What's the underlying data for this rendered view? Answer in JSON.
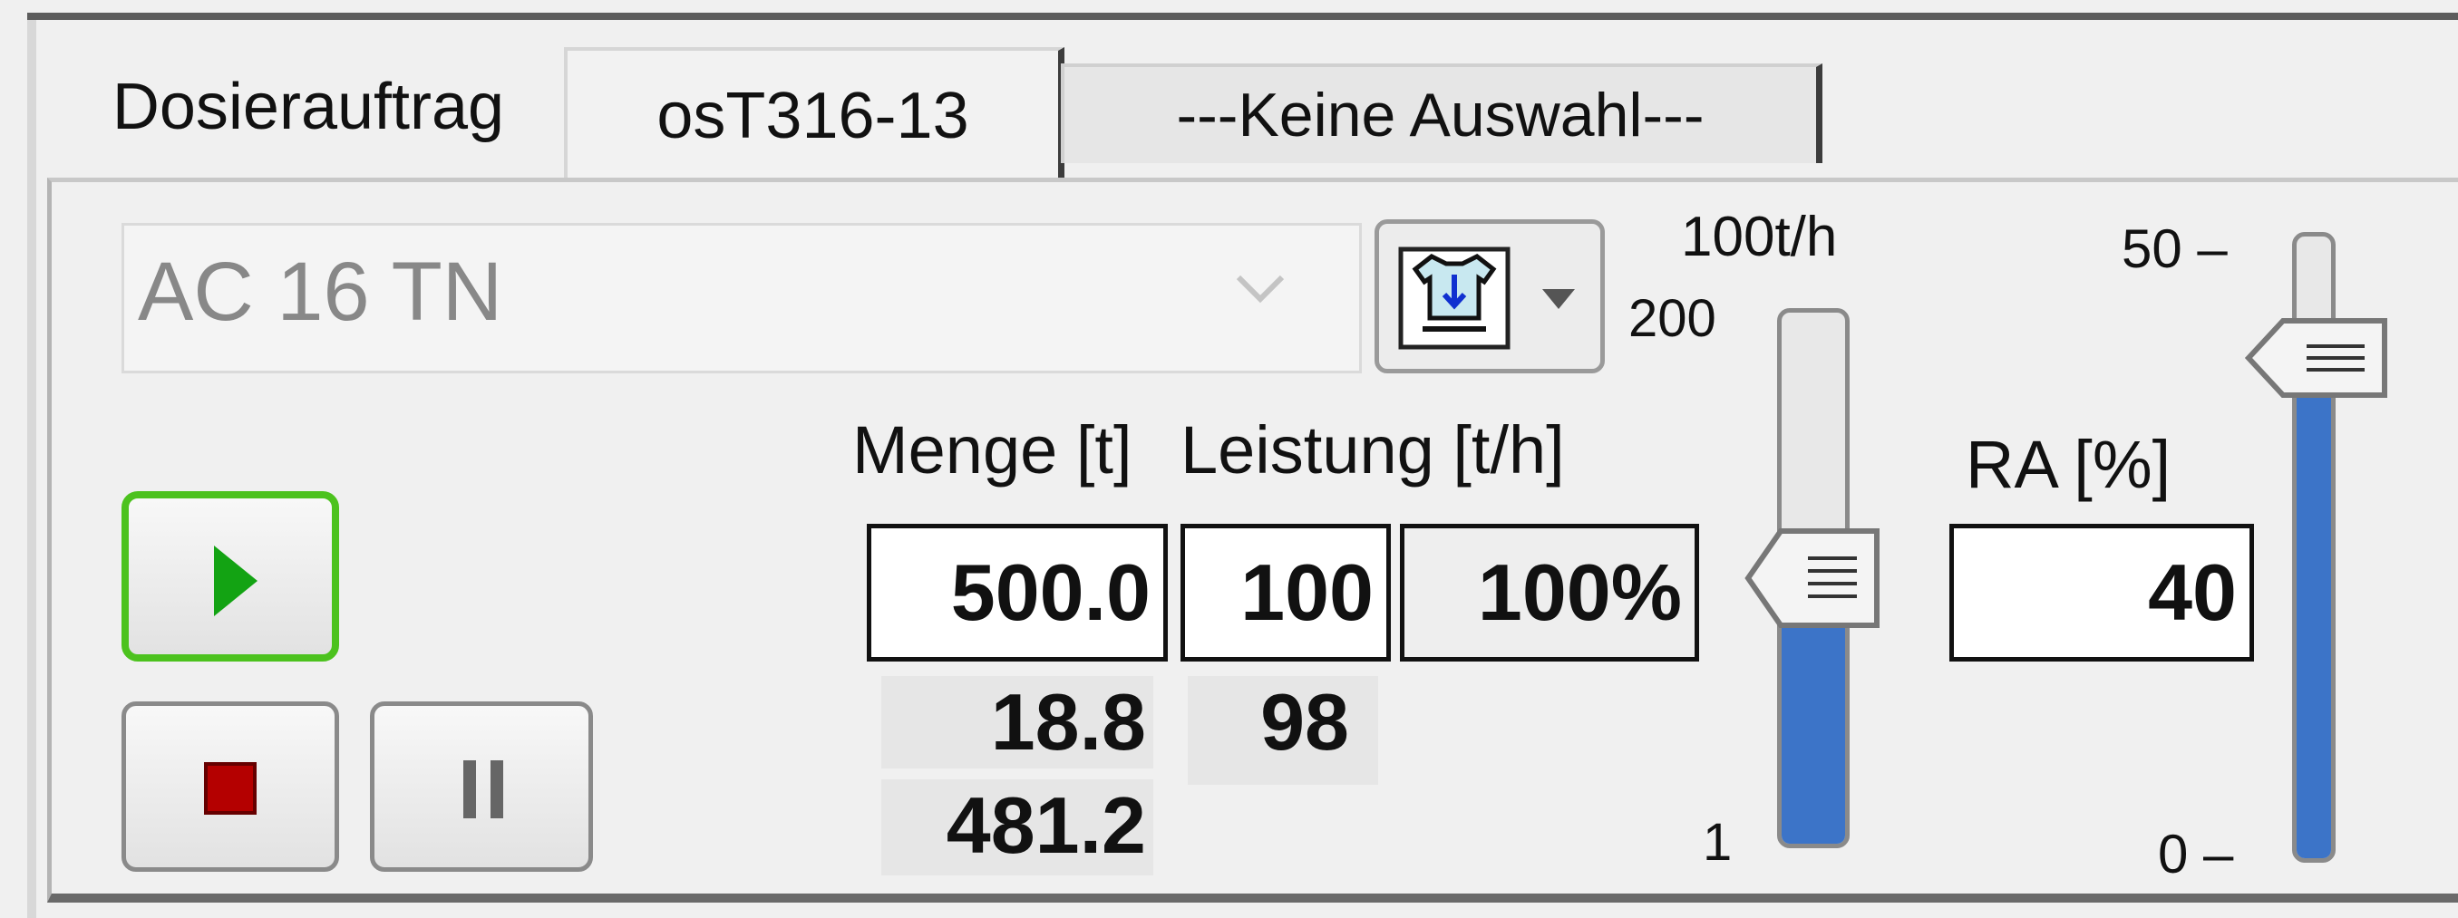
{
  "tabs": [
    {
      "label": "Dosierauftrag",
      "active": false
    },
    {
      "label": "osT316-13",
      "active": true
    },
    {
      "label": "---Keine Auswahl---",
      "active": false
    }
  ],
  "recipe": {
    "value": "AC 16 TN"
  },
  "buttons": {
    "start": "play-icon",
    "stop": "stop-icon",
    "pause": "pause-icon",
    "recipe_menu": "recipe-select-icon"
  },
  "columns": {
    "menge": "Menge [t]",
    "leistung": "Leistung [t/h]",
    "ra": "RA [%]"
  },
  "values": {
    "menge_setpoint": "500.0",
    "leistung_setpoint": "100",
    "leistung_percent": "100%",
    "ra_setpoint": "40",
    "menge_actual": "18.8",
    "leistung_actual": "98",
    "menge_remaining": "481.2"
  },
  "leistung_slider": {
    "top_label": "100t/h",
    "max_label": "200",
    "min_label": "1",
    "level": 0.5
  },
  "ra_slider": {
    "max_label": "50 –",
    "min_label": "0 –",
    "level": 0.8
  },
  "colors": {
    "start_border": "#4cc21e",
    "slider_fill": "#3c74c8",
    "stop": "#b40000",
    "play": "#13a313"
  }
}
